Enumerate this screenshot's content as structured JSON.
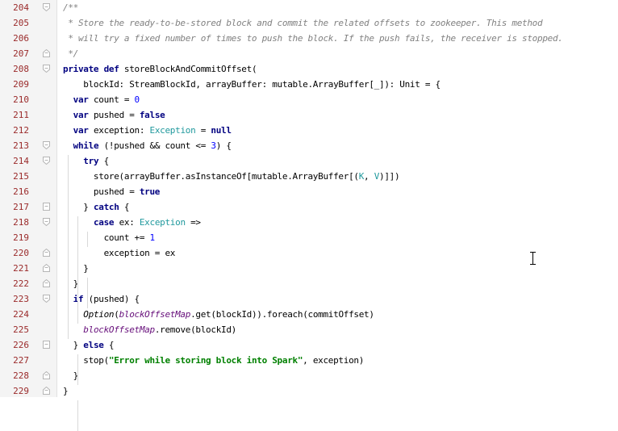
{
  "editor": {
    "lines": [
      {
        "n": "204",
        "fold": "open",
        "segs": [
          {
            "t": "/**",
            "c": "cm"
          }
        ]
      },
      {
        "n": "205",
        "segs": [
          {
            "t": " * Store the ready-to-be-stored block and commit the related offsets to zookeeper. This method",
            "c": "cm"
          }
        ]
      },
      {
        "n": "206",
        "segs": [
          {
            "t": " * will try a fixed number of times to push the block. If the push fails, the receiver is stopped.",
            "c": "cm"
          }
        ]
      },
      {
        "n": "207",
        "fold": "close",
        "segs": [
          {
            "t": " */",
            "c": "cm"
          }
        ]
      },
      {
        "n": "208",
        "fold": "open",
        "segs": [
          {
            "t": "private ",
            "c": "kw"
          },
          {
            "t": "def ",
            "c": "kw"
          },
          {
            "t": "storeBlockAndCommitOffset("
          }
        ]
      },
      {
        "n": "209",
        "segs": [
          {
            "t": "    blockId: StreamBlockId, arrayBuffer: mutable.ArrayBuffer[_]): Unit = {"
          }
        ]
      },
      {
        "n": "210",
        "segs": [
          {
            "t": "  "
          },
          {
            "t": "var ",
            "c": "kw"
          },
          {
            "t": "count = "
          },
          {
            "t": "0",
            "c": "num"
          }
        ]
      },
      {
        "n": "211",
        "segs": [
          {
            "t": "  "
          },
          {
            "t": "var ",
            "c": "kw"
          },
          {
            "t": "pushed = "
          },
          {
            "t": "false",
            "c": "kw"
          }
        ]
      },
      {
        "n": "212",
        "segs": [
          {
            "t": "  "
          },
          {
            "t": "var ",
            "c": "kw"
          },
          {
            "t": "exception: "
          },
          {
            "t": "Exception",
            "c": "ty"
          },
          {
            "t": " = "
          },
          {
            "t": "null",
            "c": "kw"
          }
        ]
      },
      {
        "n": "213",
        "fold": "open",
        "segs": [
          {
            "t": "  "
          },
          {
            "t": "while ",
            "c": "kw"
          },
          {
            "t": "(!pushed && count <= "
          },
          {
            "t": "3",
            "c": "num"
          },
          {
            "t": ") {"
          }
        ]
      },
      {
        "n": "214",
        "fold": "open",
        "segs": [
          {
            "t": "    "
          },
          {
            "t": "try ",
            "c": "kw"
          },
          {
            "t": "{"
          }
        ]
      },
      {
        "n": "215",
        "segs": [
          {
            "t": "      store(arrayBuffer.asInstanceOf[mutable.ArrayBuffer[("
          },
          {
            "t": "K",
            "c": "ty"
          },
          {
            "t": ", "
          },
          {
            "t": "V",
            "c": "ty"
          },
          {
            "t": ")]])"
          }
        ]
      },
      {
        "n": "216",
        "segs": [
          {
            "t": "      pushed = "
          },
          {
            "t": "true",
            "c": "kw"
          }
        ]
      },
      {
        "n": "217",
        "fold": "mid",
        "segs": [
          {
            "t": "    } "
          },
          {
            "t": "catch ",
            "c": "kw"
          },
          {
            "t": "{"
          }
        ]
      },
      {
        "n": "218",
        "fold": "open",
        "segs": [
          {
            "t": "      "
          },
          {
            "t": "case ",
            "c": "kw"
          },
          {
            "t": "ex: "
          },
          {
            "t": "Exception",
            "c": "ty"
          },
          {
            "t": " =>"
          }
        ]
      },
      {
        "n": "219",
        "segs": [
          {
            "t": "        count += "
          },
          {
            "t": "1",
            "c": "num"
          }
        ]
      },
      {
        "n": "220",
        "fold": "close",
        "segs": [
          {
            "t": "        exception = ex"
          }
        ]
      },
      {
        "n": "221",
        "fold": "close",
        "segs": [
          {
            "t": "    }"
          }
        ]
      },
      {
        "n": "222",
        "fold": "close",
        "segs": [
          {
            "t": "  }"
          }
        ]
      },
      {
        "n": "223",
        "fold": "open",
        "segs": [
          {
            "t": "  "
          },
          {
            "t": "if ",
            "c": "kw"
          },
          {
            "t": "(pushed) {"
          }
        ]
      },
      {
        "n": "224",
        "segs": [
          {
            "t": "    "
          },
          {
            "t": "Option",
            "c": "it"
          },
          {
            "t": "("
          },
          {
            "t": "blockOffsetMap",
            "c": "mf"
          },
          {
            "t": ".get(blockId)).foreach(commitOffset)"
          }
        ]
      },
      {
        "n": "225",
        "segs": [
          {
            "t": "    "
          },
          {
            "t": "blockOffsetMap",
            "c": "mf"
          },
          {
            "t": ".remove(blockId)"
          }
        ]
      },
      {
        "n": "226",
        "fold": "mid",
        "segs": [
          {
            "t": "  } "
          },
          {
            "t": "else ",
            "c": "kw"
          },
          {
            "t": "{"
          }
        ]
      },
      {
        "n": "227",
        "segs": [
          {
            "t": "    stop("
          },
          {
            "t": "\"Error while storing block into Spark\"",
            "c": "str"
          },
          {
            "t": ", exception)"
          }
        ]
      },
      {
        "n": "228",
        "fold": "close",
        "segs": [
          {
            "t": "  }"
          }
        ]
      },
      {
        "n": "229",
        "fold": "close",
        "segs": [
          {
            "t": "}"
          }
        ]
      }
    ]
  },
  "colors": {
    "keyword": "#000080",
    "comment": "#808080",
    "number": "#0000ff",
    "string": "#008000",
    "type": "#20999d",
    "field": "#660e7a",
    "line_number": "#9a2a2a"
  },
  "icons": {
    "fold": "fold-marker-icon",
    "cursor": "text-cursor-icon"
  }
}
